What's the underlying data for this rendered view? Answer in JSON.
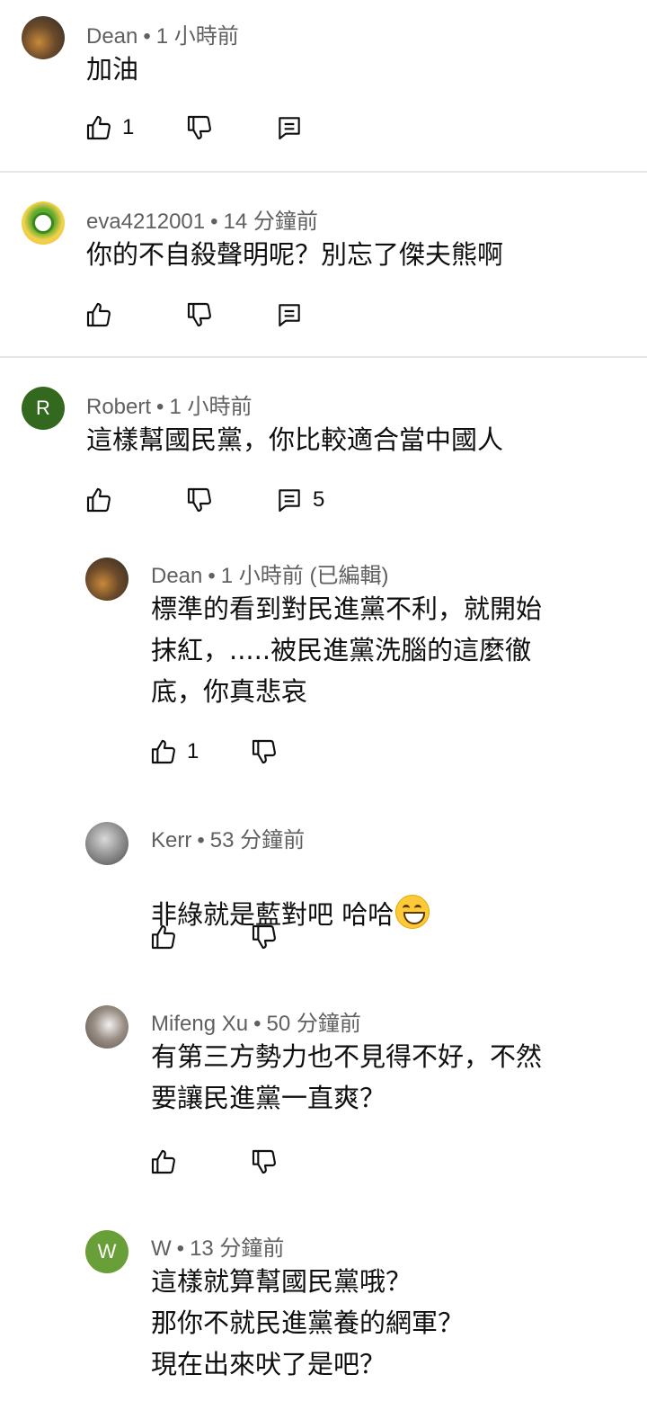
{
  "comments": [
    {
      "author": "Dean",
      "time": "1 小時前",
      "text": "加油",
      "likes": "1",
      "avatar": "photo-dean"
    },
    {
      "author": "eva4212001",
      "time": "14 分鐘前",
      "text": "你的不自殺聲明呢？別忘了傑夫熊啊",
      "likes": "",
      "avatar": "yoshi"
    },
    {
      "author": "Robert",
      "time": "1 小時前",
      "text": "這樣幫國民黨，你比較適合當中國人",
      "likes": "",
      "replies": "5",
      "avatar_letter": "R",
      "avatar_color": "#33691e"
    }
  ],
  "replies": [
    {
      "author": "Dean",
      "time": "1 小時前 (已編輯)",
      "text": "標準的看到對民進黨不利，就開始\n抹紅，.....被民進黨洗腦的這麼徹\n底，你真悲哀",
      "likes": "1",
      "avatar": "photo-dean"
    },
    {
      "author": "Kerr",
      "time": "53 分鐘前",
      "text": "非綠就是藍對吧 哈哈",
      "likes": "",
      "avatar": "photo-kerr"
    },
    {
      "author": "Mifeng Xu",
      "time": "50 分鐘前",
      "text": "有第三方勢力也不見得不好，不然\n要讓民進黨一直爽？",
      "likes": "",
      "avatar": "photo-cat"
    },
    {
      "author": "W",
      "time": "13 分鐘前",
      "text": "這樣就算幫國民黨哦？\n那你不就民進黨養的網軍？\n現在出來吠了是吧？",
      "likes": "",
      "avatar_letter": "W",
      "avatar_color": "#689f38"
    }
  ],
  "separator": "•",
  "icons": [
    "thumb-up-icon",
    "thumb-down-icon",
    "reply-icon",
    "grinning-emoji-icon"
  ]
}
